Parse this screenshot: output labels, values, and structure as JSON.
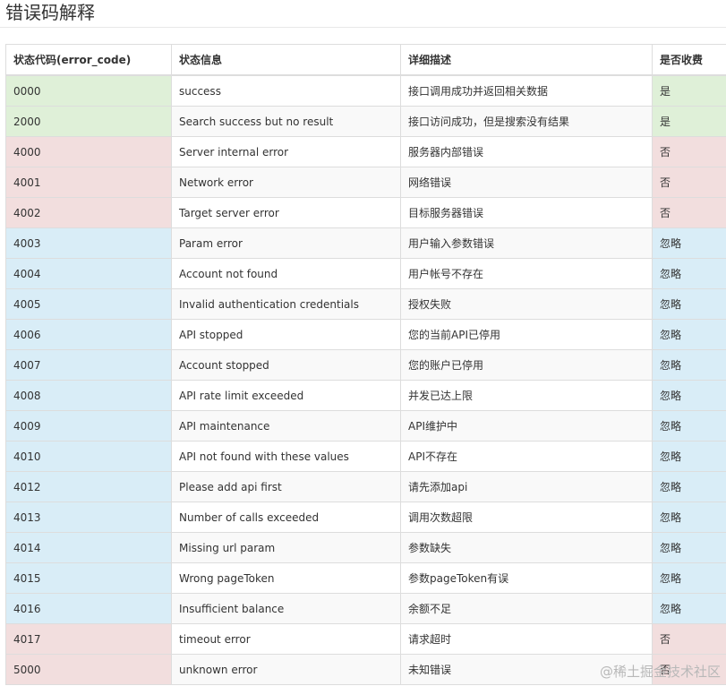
{
  "page": {
    "title": "错误码解释",
    "watermark": "@稀土掘金技术社区"
  },
  "table": {
    "headers": [
      "状态代码(error_code)",
      "状态信息",
      "详细描述",
      "是否收费"
    ],
    "status_colors": {
      "success": "#dff0d8",
      "danger": "#f2dede",
      "info": "#d9edf7"
    },
    "rows": [
      {
        "code": "0000",
        "message": "success",
        "description": "接口调用成功并返回相关数据",
        "charged": "是",
        "status": "success"
      },
      {
        "code": "2000",
        "message": "Search success but no result",
        "description": "接口访问成功，但是搜索没有结果",
        "charged": "是",
        "status": "success"
      },
      {
        "code": "4000",
        "message": "Server internal error",
        "description": "服务器内部错误",
        "charged": "否",
        "status": "danger"
      },
      {
        "code": "4001",
        "message": "Network error",
        "description": "网络错误",
        "charged": "否",
        "status": "danger"
      },
      {
        "code": "4002",
        "message": "Target server error",
        "description": "目标服务器错误",
        "charged": "否",
        "status": "danger"
      },
      {
        "code": "4003",
        "message": "Param error",
        "description": "用户输入参数错误",
        "charged": "忽略",
        "status": "info"
      },
      {
        "code": "4004",
        "message": "Account not found",
        "description": "用户帐号不存在",
        "charged": "忽略",
        "status": "info"
      },
      {
        "code": "4005",
        "message": "Invalid authentication credentials",
        "description": "授权失败",
        "charged": "忽略",
        "status": "info"
      },
      {
        "code": "4006",
        "message": "API stopped",
        "description": "您的当前API已停用",
        "charged": "忽略",
        "status": "info"
      },
      {
        "code": "4007",
        "message": "Account stopped",
        "description": "您的账户已停用",
        "charged": "忽略",
        "status": "info"
      },
      {
        "code": "4008",
        "message": "API rate limit exceeded",
        "description": "并发已达上限",
        "charged": "忽略",
        "status": "info"
      },
      {
        "code": "4009",
        "message": "API maintenance",
        "description": "API维护中",
        "charged": "忽略",
        "status": "info"
      },
      {
        "code": "4010",
        "message": "API not found with these values",
        "description": "API不存在",
        "charged": "忽略",
        "status": "info"
      },
      {
        "code": "4012",
        "message": "Please add api first",
        "description": "请先添加api",
        "charged": "忽略",
        "status": "info"
      },
      {
        "code": "4013",
        "message": "Number of calls exceeded",
        "description": "调用次数超限",
        "charged": "忽略",
        "status": "info"
      },
      {
        "code": "4014",
        "message": "Missing url param",
        "description": "参数缺失",
        "charged": "忽略",
        "status": "info"
      },
      {
        "code": "4015",
        "message": "Wrong pageToken",
        "description": "参数pageToken有误",
        "charged": "忽略",
        "status": "info"
      },
      {
        "code": "4016",
        "message": "Insufficient balance",
        "description": "余额不足",
        "charged": "忽略",
        "status": "info"
      },
      {
        "code": "4017",
        "message": "timeout error",
        "description": "请求超时",
        "charged": "否",
        "status": "danger"
      },
      {
        "code": "5000",
        "message": "unknown error",
        "description": "未知错误",
        "charged": "否",
        "status": "danger"
      }
    ]
  }
}
